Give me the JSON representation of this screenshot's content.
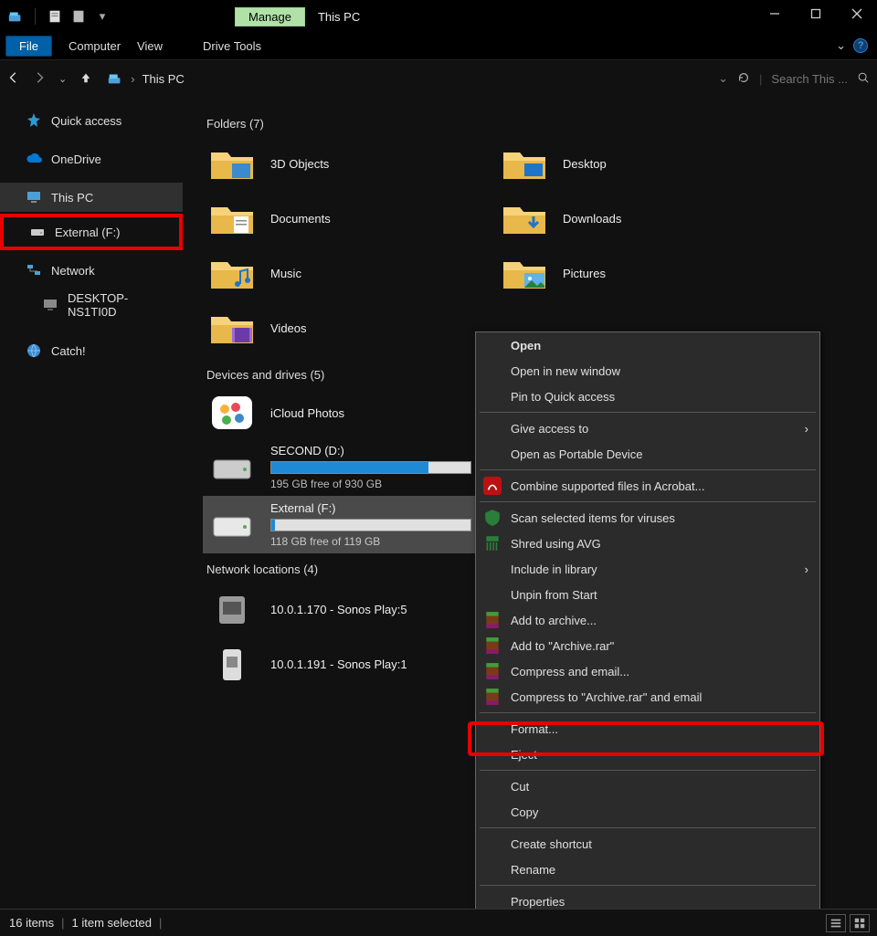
{
  "titlebar": {
    "manage": "Manage",
    "title": "This PC"
  },
  "ribbon": {
    "file": "File",
    "tabs": [
      "Computer",
      "View"
    ],
    "drive_tools": "Drive Tools"
  },
  "address": {
    "location": "This PC",
    "search_placeholder": "Search This ..."
  },
  "sidebar": {
    "quick_access": "Quick access",
    "onedrive": "OneDrive",
    "this_pc": "This PC",
    "external": "External (F:)",
    "network": "Network",
    "desktop_entry": "DESKTOP-NS1TI0D",
    "catch": "Catch!"
  },
  "sections": {
    "folders": "Folders (7)",
    "devices": "Devices and drives (5)",
    "network": "Network locations (4)"
  },
  "folders": [
    {
      "name": "3D Objects"
    },
    {
      "name": "Desktop"
    },
    {
      "name": "Documents"
    },
    {
      "name": "Downloads"
    },
    {
      "name": "Music"
    },
    {
      "name": "Pictures"
    },
    {
      "name": "Videos"
    }
  ],
  "drives": {
    "icloud": "iCloud Photos",
    "second": {
      "name": "SECOND (D:)",
      "free": "195 GB free of 930 GB",
      "fill": 79
    },
    "external": {
      "name": "External (F:)",
      "free": "118 GB free of 119 GB",
      "fill": 2
    }
  },
  "network": [
    "10.0.1.170 - Sonos Play:5",
    "10.0.1.191 - Sonos Play:1"
  ],
  "ctx": {
    "open": "Open",
    "open_new": "Open in new window",
    "pin_qa": "Pin to Quick access",
    "give_access": "Give access to",
    "open_portable": "Open as Portable Device",
    "combine_acrobat": "Combine supported files in Acrobat...",
    "scan": "Scan selected items for viruses",
    "shred": "Shred using AVG",
    "include_lib": "Include in library",
    "unpin_start": "Unpin from Start",
    "add_archive": "Add to archive...",
    "add_archive_rar": "Add to \"Archive.rar\"",
    "compress_email": "Compress and email...",
    "compress_rar_email": "Compress to \"Archive.rar\" and email",
    "format": "Format...",
    "eject": "Eject",
    "cut": "Cut",
    "copy": "Copy",
    "create_shortcut": "Create shortcut",
    "rename": "Rename",
    "properties": "Properties"
  },
  "status": {
    "items": "16 items",
    "selected": "1 item selected"
  }
}
